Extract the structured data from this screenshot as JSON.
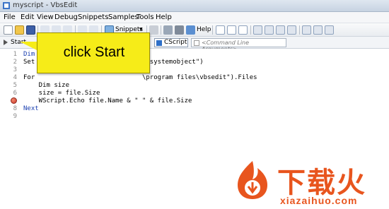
{
  "window": {
    "title": "myscript - VbsEdit"
  },
  "menu": [
    {
      "label": "File"
    },
    {
      "label": "Edit"
    },
    {
      "label": "View"
    },
    {
      "label": "Debug"
    },
    {
      "label": "Snippets"
    },
    {
      "label": "Samples"
    },
    {
      "label": "Tools"
    },
    {
      "label": "Help"
    }
  ],
  "toolbar": {
    "snippets_label": "Snippets",
    "help_label": "Help"
  },
  "runbar": {
    "start_label": "Start",
    "engine_label": "CScript",
    "cmdline_placeholder": "<Command Line Arguments>"
  },
  "callout": {
    "text": "click Start"
  },
  "editor": {
    "lines": [
      {
        "num": "1",
        "code": "Dim"
      },
      {
        "num": "2",
        "code": "Set                           ilesystemobject\")"
      },
      {
        "num": "3",
        "code": ""
      },
      {
        "num": "4",
        "code": "For                            \\program files\\vbsedit\").Files"
      },
      {
        "num": "5",
        "code": "    Dim size"
      },
      {
        "num": "6",
        "code": "    size = file.Size"
      },
      {
        "num": "7",
        "code": "    WScript.Echo file.Name & \" \" & file.Size"
      },
      {
        "num": "8",
        "code": "Next"
      },
      {
        "num": "9",
        "code": ""
      }
    ],
    "breakpoint_line": 7
  },
  "watermark": {
    "brand": "下载火",
    "url": "xiazaihuo.com"
  },
  "colors": {
    "callout": "#f6ec18",
    "watermark": "#e8551e",
    "keyword": "#1a3fb0"
  }
}
